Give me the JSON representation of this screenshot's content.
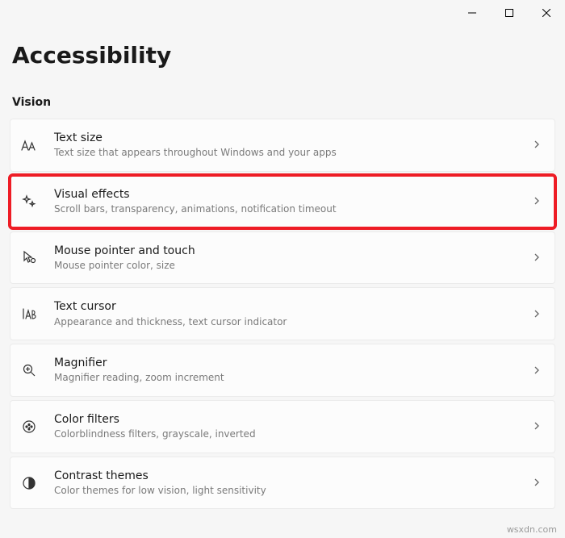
{
  "window": {
    "minimize": "—",
    "maximize": "☐",
    "close": "✕"
  },
  "page_title": "Accessibility",
  "section_header": "Vision",
  "items": [
    {
      "key": "text-size",
      "title": "Text size",
      "subtitle": "Text size that appears throughout Windows and your apps",
      "highlighted": false
    },
    {
      "key": "visual-effects",
      "title": "Visual effects",
      "subtitle": "Scroll bars, transparency, animations, notification timeout",
      "highlighted": true
    },
    {
      "key": "mouse-pointer",
      "title": "Mouse pointer and touch",
      "subtitle": "Mouse pointer color, size",
      "highlighted": false
    },
    {
      "key": "text-cursor",
      "title": "Text cursor",
      "subtitle": "Appearance and thickness, text cursor indicator",
      "highlighted": false
    },
    {
      "key": "magnifier",
      "title": "Magnifier",
      "subtitle": "Magnifier reading, zoom increment",
      "highlighted": false
    },
    {
      "key": "color-filters",
      "title": "Color filters",
      "subtitle": "Colorblindness filters, grayscale, inverted",
      "highlighted": false
    },
    {
      "key": "contrast-themes",
      "title": "Contrast themes",
      "subtitle": "Color themes for low vision, light sensitivity",
      "highlighted": false
    }
  ],
  "watermark": "wsxdn.com"
}
